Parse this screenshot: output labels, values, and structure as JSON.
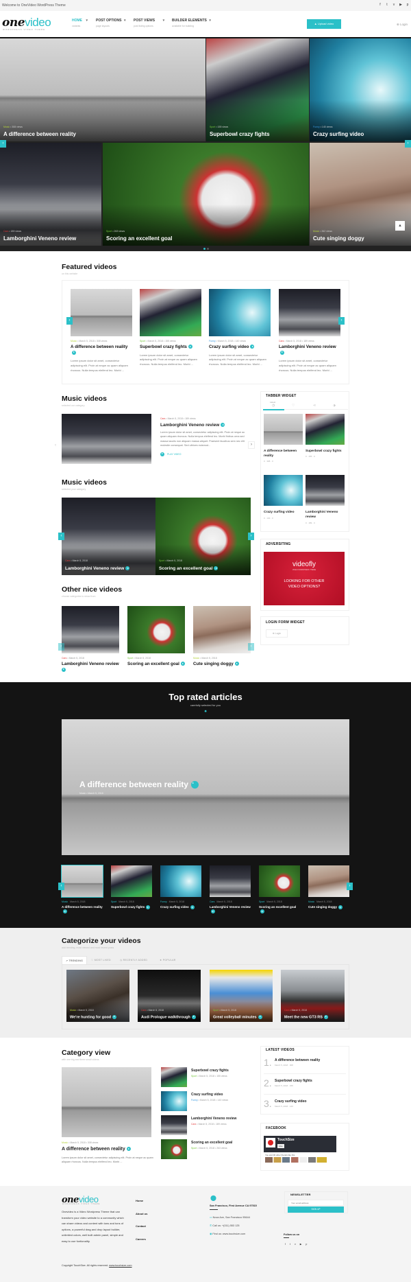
{
  "topbar": {
    "welcome": "Welcome to OneVideo WordPress Theme",
    "social_icons": [
      "facebook-icon",
      "twitter-icon",
      "vimeo-icon",
      "youtube-icon",
      "pinterest-icon"
    ]
  },
  "header": {
    "logo_one": "one",
    "logo_video": "video",
    "logo_tagline": "WORDPRESS VIDEO THEME",
    "nav": [
      {
        "label": "HOME",
        "sub": "variants"
      },
      {
        "label": "POST OPTIONS",
        "sub": "page layouts"
      },
      {
        "label": "POST VIEWS",
        "sub": "post listing options"
      },
      {
        "label": "BUILDER ELEMENTS",
        "sub": "available for building"
      }
    ],
    "upload_label": "Upload video",
    "login_label": "Login"
  },
  "hero": {
    "tiles": [
      {
        "category": "Music",
        "views": "308 views",
        "title": "A difference between reality"
      },
      {
        "category": "Sport",
        "views": "155 views",
        "title": "Superbowl crazy fights"
      },
      {
        "category": "Funny",
        "views": "140 views",
        "title": "Crazy surfing video"
      },
      {
        "category": "Cars",
        "views": "189 views",
        "title": "Lamborghini Veneno review"
      },
      {
        "category": "Sport",
        "views": "263 views",
        "title": "Scoring an excellent goal"
      },
      {
        "category": "Music",
        "views": "262 views",
        "title": "Cute singing doggy"
      }
    ]
  },
  "featured": {
    "title": "Featured videos",
    "subtitle": "on this website",
    "items": [
      {
        "category": "Music",
        "meta": "March 5, 2018 • 308 views",
        "title": "A difference between reality",
        "desc": "Lorem ipsum dolor sit amet, consectetur adipiscing elit. Proin at neque ac quam aliquam rhoncus. Nulla tempus eleifend leo. Morbi ..."
      },
      {
        "category": "Sport",
        "meta": "March 5, 2018 • 155 views",
        "title": "Superbowl crazy fights",
        "desc": "Lorem ipsum dolor sit amet, consectetur adipiscing elit. Proin at neque ac quam aliquam rhoncus. Nulla tempus eleifend leo. Morbi ..."
      },
      {
        "category": "Funny",
        "meta": "March 5, 2018 • 140 views",
        "title": "Crazy surfing video",
        "desc": "Lorem ipsum dolor sit amet, consectetur adipiscing elit. Proin at neque ac quam aliquam rhoncus. Nulla tempus eleifend leo. Morbi ..."
      },
      {
        "category": "Cars",
        "meta": "March 5, 2018 • 189 views",
        "title": "Lamborghini Veneno review",
        "desc": "Lorem ipsum dolor sit amet, consectetur adipiscing elit. Proin at neque ac quam aliquam rhoncus. Nulla tempus eleifend leo. Morbi ..."
      }
    ]
  },
  "music1": {
    "title": "Music videos",
    "subtitle": "selected our category",
    "item": {
      "category": "Cars",
      "meta": "March 5, 2018 • 189 views",
      "title": "Lamborghini Veneno review",
      "desc": "Lorem ipsum dolor sit amet, consectetur adipiscing elit. Proin at neque ac quam aliquam rhoncus. Nulla tempus eleifend leo. Morbi finibus urna sed massa iaculis non aliquam massa aliquet. Praesent faucibus sem nec elit molestie consequat. Sed ultrices euismod...",
      "play_label": "PLAY VIDEO"
    }
  },
  "music2": {
    "title": "Music videos",
    "subtitle": "selected your category",
    "items": [
      {
        "category": "Cars",
        "meta": "March 5, 2018",
        "title": "Lamborghini Veneno review"
      },
      {
        "category": "Sport",
        "meta": "March 5, 2018",
        "title": "Scoring an excellent goal"
      }
    ]
  },
  "other": {
    "title": "Other nice videos",
    "subtitle": "choose categories to show from",
    "items": [
      {
        "category": "Cars",
        "meta": "March 5, 2018",
        "title": "Lamborghini Veneno review"
      },
      {
        "category": "Sport",
        "meta": "March 5, 2018",
        "title": "Scoring an excellent goal"
      },
      {
        "category": "Music",
        "meta": "March 5, 2018",
        "title": "Cute singing doggy"
      }
    ]
  },
  "sidebar": {
    "tabber": {
      "title": "TABBER WIDGET",
      "tab_latest": "Latest",
      "items": [
        {
          "title": "A difference between reality",
          "meta": "0 · 308 · 0"
        },
        {
          "title": "Superbowl crazy fights",
          "meta": "0 · 155 · 0"
        },
        {
          "title": "Crazy surfing video",
          "meta": "0 · 140 · 0"
        },
        {
          "title": "Lamborghini Veneno review",
          "meta": "0 · 189 · 0"
        }
      ]
    },
    "ad": {
      "title": "ADVERSITING",
      "brand": "videofly",
      "brand_sub": "VIDEO WORDPRESS THEME",
      "line1": "LOOKING FOR OTHER",
      "line2": "VIDEO OPTIONS?"
    },
    "login": {
      "title": "LOGIN FORM WIDGET",
      "button": "Login"
    }
  },
  "top_rated": {
    "title": "Top rated articles",
    "subtitle": "carefully selected for you",
    "feature_title": "A difference between reality",
    "feature_meta": "Music • March 5, 2018",
    "items": [
      {
        "category": "Music",
        "meta": "March 5, 2018",
        "title": "A difference between reality"
      },
      {
        "category": "Sport",
        "meta": "March 5, 2018",
        "title": "Superbowl crazy fights"
      },
      {
        "category": "Funny",
        "meta": "March 5, 2018",
        "title": "Crazy surfing video"
      },
      {
        "category": "Cars",
        "meta": "March 5, 2018",
        "title": "Lamborghini Veneno review"
      },
      {
        "category": "Sport",
        "meta": "March 5, 2018",
        "title": "Scoring an excellent goal"
      },
      {
        "category": "Music",
        "meta": "March 5, 2018",
        "title": "Cute singing doggy"
      }
    ]
  },
  "categorize": {
    "title": "Categorize your videos",
    "subtitle": "add trending, most viewed and most recent posts",
    "tabs": [
      "TRENDING",
      "MOST LIKED",
      "RECENTLY ADDED",
      "POPULAR"
    ],
    "items": [
      {
        "category": "Music",
        "meta": "March 5, 2018",
        "title": "We're hunting for good"
      },
      {
        "category": "Cars",
        "meta": "March 5, 2018",
        "title": "Audi Prologue walkthrough"
      },
      {
        "category": "Sport",
        "meta": "March 5, 2018",
        "title": "Great volleyball minutes"
      },
      {
        "category": "Cars",
        "meta": "March 5, 2018",
        "title": "Meet the new GT3 RS"
      }
    ]
  },
  "category_view": {
    "title": "Category view",
    "subtitle": "with one big and three small videos",
    "main": {
      "category": "Music",
      "meta": "March 5, 2018 • 308 views",
      "title": "A difference between reality",
      "desc": "Lorem ipsum dolor sit amet, consectetur adipiscing elit. Proin at neque ac quam aliquam rhoncus. Nulla tempus eleifend leo. Morbi ..."
    },
    "list": [
      {
        "category": "Sport",
        "meta": "March 5, 2018 • 155 views",
        "title": "Superbowl crazy fights"
      },
      {
        "category": "Funny",
        "meta": "March 5, 2018 • 140 views",
        "title": "Crazy surfing video"
      },
      {
        "category": "Cars",
        "meta": "March 5, 2018 • 189 views",
        "title": "Lamborghini Veneno review"
      },
      {
        "category": "Sport",
        "meta": "March 5, 2018 • 263 views",
        "title": "Scoring an excellent goal"
      }
    ]
  },
  "latest": {
    "title": "LATEST VIDEOS",
    "items": [
      {
        "num": "1.",
        "title": "A difference between reality",
        "meta": "March 5, 2018 · 308"
      },
      {
        "num": "2.",
        "title": "Superbowl crazy fights",
        "meta": "March 5, 2018 · 155"
      },
      {
        "num": "3.",
        "title": "Crazy surfing video",
        "meta": "March 5, 2018 · 140"
      }
    ]
  },
  "facebook": {
    "title": "FACEBOOK",
    "page_name": "TouchSize",
    "like": "Like",
    "friends": "You and 30 other friends like this"
  },
  "footer": {
    "about": "Onevideo is a Video Wordpress Theme that can transform your video website to a community which can share videos and content with tons and tons of options, a powerful drag and drop layout builder, unlimited colors, well built admin panel, simple and easy to use funtionality.",
    "links": [
      "Home",
      "About us",
      "Contact",
      "Careers"
    ],
    "address_title": "San Francisco, First Avenue CA 97515",
    "address": "Nova Ave, San Francisco 95644",
    "phone": "Call us: +(011) 553 125",
    "web": "Find us: www.touchsize.com",
    "newsletter_title": "NEWSLETTER",
    "email_placeholder": "Your email address",
    "signup": "SIGN UP",
    "follow": "Follow us on",
    "copyright": "Copyright TouchSize. All rights reserved.",
    "copyright_link": "www.touchsize.com"
  },
  "colors": {
    "accent": "#2bc0c8",
    "music": "#b5d33d",
    "sport": "#77c63e",
    "funny": "#3b9ae0",
    "cars": "#e33b3b",
    "ad_red": "#c8102e"
  }
}
